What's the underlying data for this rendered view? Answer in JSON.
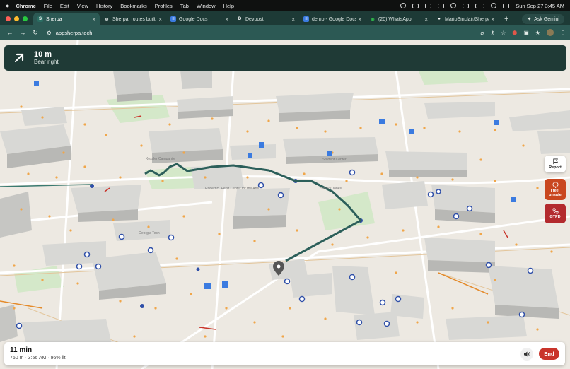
{
  "menubar": {
    "app": "Chrome",
    "items": [
      "File",
      "Edit",
      "View",
      "History",
      "Bookmarks",
      "Profiles",
      "Tab",
      "Window",
      "Help"
    ],
    "clock": "Sun Sep 27  3:45 AM"
  },
  "tabs": [
    {
      "label": "Sherpa",
      "active": true,
      "favicon": "S",
      "favicon_color": "#2a6d62"
    },
    {
      "label": "Sherpa, routes built a",
      "active": false,
      "favicon": "⊕",
      "favicon_color": "#556"
    },
    {
      "label": "Google Docs",
      "active": false,
      "favicon": "≡",
      "favicon_color": "#3b7be0"
    },
    {
      "label": "Devpost",
      "active": false,
      "favicon": "D",
      "favicon_color": "#333"
    },
    {
      "label": "demo - Google Docs",
      "active": false,
      "favicon": "≡",
      "favicon_color": "#3b7be0"
    },
    {
      "label": "(20) WhatsApp",
      "active": false,
      "favicon": "◉",
      "favicon_color": "#2fb34b"
    },
    {
      "label": "MarioSinclair/Sherpa",
      "active": false,
      "favicon": "●",
      "favicon_color": "#222"
    }
  ],
  "new_tab": "+",
  "ask_gemini": "Ask Gemini",
  "address": {
    "url": "appsherpa.tech"
  },
  "navigation": {
    "distance": "10 m",
    "instruction": "Bear right",
    "icon": "arrow-up-right-icon"
  },
  "side_buttons": {
    "report": "Report",
    "unsafe_line1": "I feel",
    "unsafe_line2": "unsafe",
    "gtpd": "GTPD"
  },
  "map_labels": {
    "building_1": "Kessler Campanile",
    "building_2": "Robert H. Ferst Center for the Arts",
    "building_3": "Student Center",
    "building_4": "Smoky Jones",
    "building_5": "Georgia Tech"
  },
  "trip": {
    "eta": "11 min",
    "details": "760 m · 3:56 AM · 96% lit",
    "end_label": "End"
  },
  "colors": {
    "route": "#2c5f5a",
    "banner": "#1f3a36",
    "end": "#c9342a",
    "unsafe": "#c9471f",
    "gtpd": "#b32a2e",
    "lamp": "#f0a64a",
    "blue_light": "#2f4fa8"
  }
}
